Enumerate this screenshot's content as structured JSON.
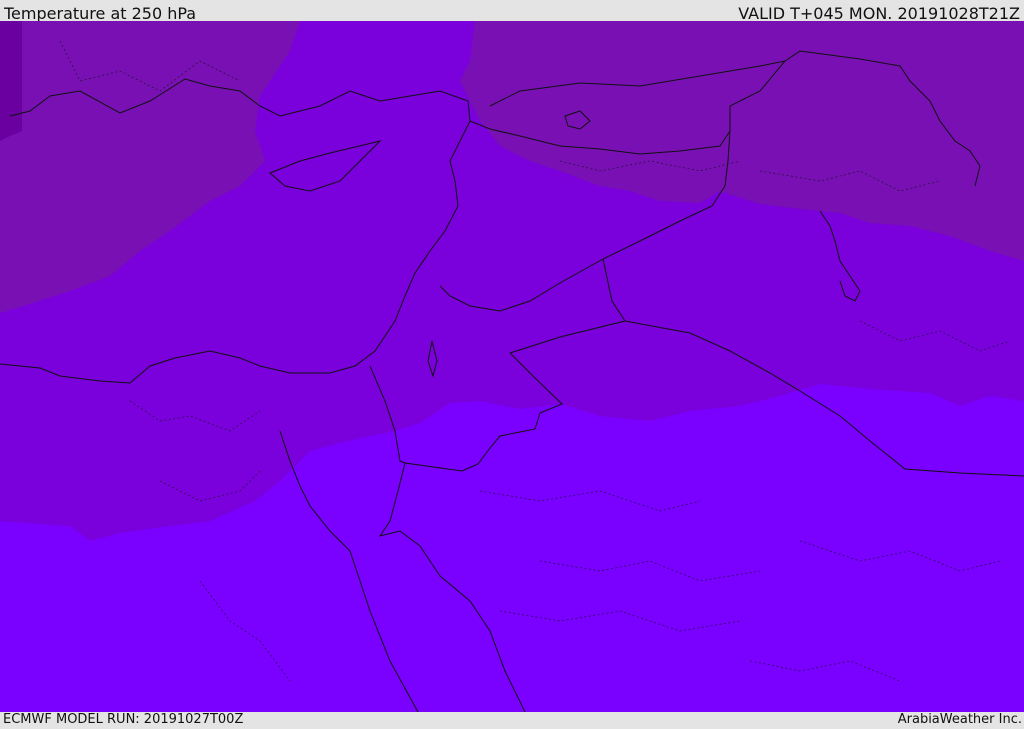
{
  "header": {
    "title": "Temperature at 250 hPa",
    "valid": "VALID T+045 MON. 20191028T21Z"
  },
  "footer": {
    "model_run": "ECMWF MODEL RUN: 20191027T00Z",
    "credit": "ArabiaWeather Inc."
  },
  "map": {
    "colors": {
      "coldest": "#6a00a0",
      "cold": "#7810b4",
      "mid": "#7a00dc",
      "warm": "#7a00ff",
      "border": "#111111"
    }
  }
}
